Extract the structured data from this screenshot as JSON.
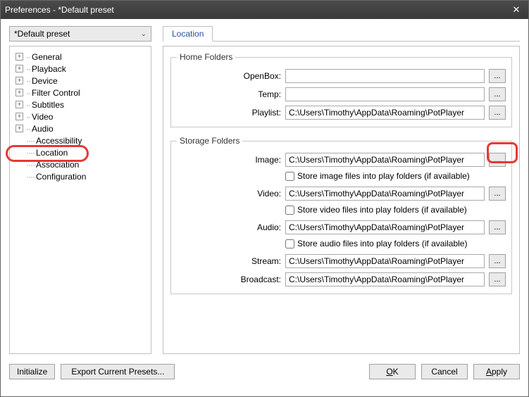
{
  "window": {
    "title": "Preferences - *Default preset",
    "close_glyph": "✕"
  },
  "preset": {
    "selected": "*Default preset"
  },
  "tabs": {
    "active": "Location"
  },
  "tree": {
    "items": [
      {
        "label": "General",
        "expandable": true
      },
      {
        "label": "Playback",
        "expandable": true
      },
      {
        "label": "Device",
        "expandable": true
      },
      {
        "label": "Filter Control",
        "expandable": true
      },
      {
        "label": "Subtitles",
        "expandable": true
      },
      {
        "label": "Video",
        "expandable": true
      },
      {
        "label": "Audio",
        "expandable": true
      },
      {
        "label": "Accessibility",
        "expandable": false
      },
      {
        "label": "Location",
        "expandable": false
      },
      {
        "label": "Association",
        "expandable": false
      },
      {
        "label": "Configuration",
        "expandable": false
      }
    ]
  },
  "home_folders": {
    "legend": "Home Folders",
    "openbox": {
      "label": "OpenBox:",
      "value": ""
    },
    "temp": {
      "label": "Temp:",
      "value": ""
    },
    "playlist": {
      "label": "Playlist:",
      "value": "C:\\Users\\Timothy\\AppData\\Roaming\\PotPlayer"
    }
  },
  "storage_folders": {
    "legend": "Storage Folders",
    "image": {
      "label": "Image:",
      "value": "C:\\Users\\Timothy\\AppData\\Roaming\\PotPlayer",
      "check_label": "Store image files into play folders (if available)"
    },
    "video": {
      "label": "Video:",
      "value": "C:\\Users\\Timothy\\AppData\\Roaming\\PotPlayer",
      "check_label": "Store video files into play folders (if available)"
    },
    "audio": {
      "label": "Audio:",
      "value": "C:\\Users\\Timothy\\AppData\\Roaming\\PotPlayer",
      "check_label": "Store audio files into play folders (if available)"
    },
    "stream": {
      "label": "Stream:",
      "value": "C:\\Users\\Timothy\\AppData\\Roaming\\PotPlayer"
    },
    "broadcast": {
      "label": "Broadcast:",
      "value": "C:\\Users\\Timothy\\AppData\\Roaming\\PotPlayer"
    }
  },
  "browse_label": "...",
  "buttons": {
    "initialize": "Initialize",
    "export": "Export Current Presets...",
    "ok": "OK",
    "cancel": "Cancel",
    "apply": "Apply"
  }
}
